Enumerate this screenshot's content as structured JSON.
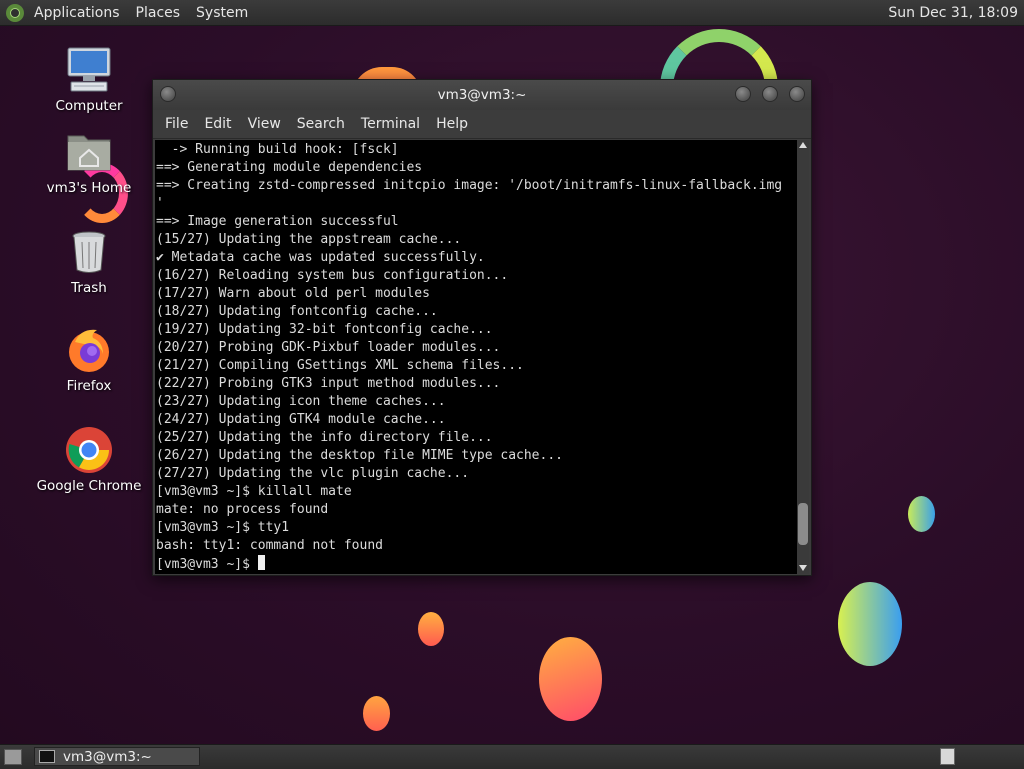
{
  "top_panel": {
    "menus": [
      "Applications",
      "Places",
      "System"
    ],
    "clock": "Sun Dec 31, 18:09"
  },
  "desktop_icons": [
    {
      "label": "Computer",
      "icon": "computer-icon"
    },
    {
      "label": "vm3's Home",
      "icon": "home-folder-icon"
    },
    {
      "label": "Trash",
      "icon": "trash-icon"
    },
    {
      "label": "Firefox",
      "icon": "firefox-icon"
    },
    {
      "label": "Google Chrome",
      "icon": "chrome-icon"
    }
  ],
  "terminal": {
    "title": "vm3@vm3:~",
    "menus": [
      "File",
      "Edit",
      "View",
      "Search",
      "Terminal",
      "Help"
    ],
    "lines": [
      "  -> Running build hook: [fsck]",
      "==> Generating module dependencies",
      "==> Creating zstd-compressed initcpio image: '/boot/initramfs-linux-fallback.img",
      "'",
      "==> Image generation successful",
      "(15/27) Updating the appstream cache...",
      "✔ Metadata cache was updated successfully.",
      "(16/27) Reloading system bus configuration...",
      "(17/27) Warn about old perl modules",
      "(18/27) Updating fontconfig cache...",
      "(19/27) Updating 32-bit fontconfig cache...",
      "(20/27) Probing GDK-Pixbuf loader modules...",
      "(21/27) Compiling GSettings XML schema files...",
      "(22/27) Probing GTK3 input method modules...",
      "(23/27) Updating icon theme caches...",
      "(24/27) Updating GTK4 module cache...",
      "(25/27) Updating the info directory file...",
      "(26/27) Updating the desktop file MIME type cache...",
      "(27/27) Updating the vlc plugin cache...",
      "[vm3@vm3 ~]$ killall mate",
      "mate: no process found",
      "[vm3@vm3 ~]$ tty1",
      "bash: tty1: command not found"
    ],
    "prompt": "[vm3@vm3 ~]$ ",
    "scroll_position": 0.95
  },
  "bottom_panel": {
    "task_label": "vm3@vm3:~"
  },
  "colors": {
    "desktop_bg": "#2b0d28",
    "terminal_bg": "#000000",
    "terminal_fg": "#dcdcdc",
    "panel_bg": "#2f2f2f"
  }
}
